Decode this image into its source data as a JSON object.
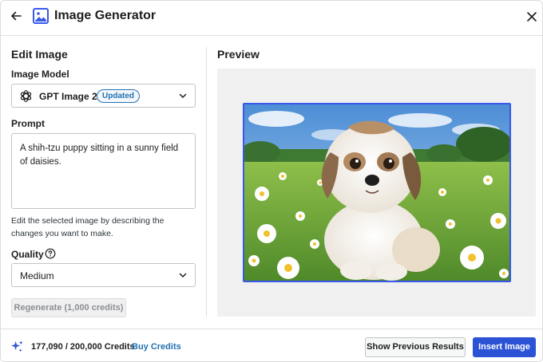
{
  "header": {
    "title": "Image Generator",
    "back_icon": "arrow-left-icon",
    "app_icon": "image-icon",
    "close_icon": "close-icon"
  },
  "edit": {
    "section_title": "Edit Image",
    "model_label": "Image Model",
    "model_name": "GPT Image 2",
    "model_badge": "Updated",
    "prompt_label": "Prompt",
    "prompt_value": "A shih-tzu puppy sitting in a sunny field of daisies.",
    "help_text": "Edit the selected image by describing the changes you want to make.",
    "quality_label": "Quality",
    "quality_value": "Medium",
    "regenerate_label": "Regenerate (1,000 credits)"
  },
  "preview": {
    "section_title": "Preview"
  },
  "footer": {
    "credits": "177,090 / 200,000 Credits",
    "buy_label": "Buy Credits",
    "previous_label": "Show Previous Results",
    "insert_label": "Insert Image"
  },
  "colors": {
    "accent": "#2c53d6",
    "link": "#2271b1",
    "selection_border": "#3858e9"
  }
}
